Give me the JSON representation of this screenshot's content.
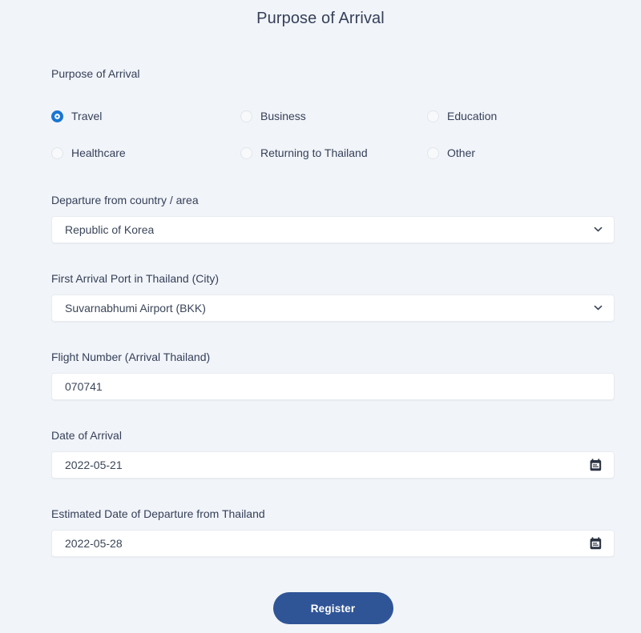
{
  "page": {
    "title": "Purpose of Arrival",
    "background_color": "#f1f4f8",
    "accent_color": "#2f5597",
    "radio_selected_color": "#1976d2"
  },
  "purpose_section": {
    "label": "Purpose of Arrival",
    "options": [
      {
        "label": "Travel",
        "selected": true
      },
      {
        "label": "Business",
        "selected": false
      },
      {
        "label": "Education",
        "selected": false
      },
      {
        "label": "Healthcare",
        "selected": false
      },
      {
        "label": "Returning to Thailand",
        "selected": false
      },
      {
        "label": "Other",
        "selected": false
      }
    ]
  },
  "fields": {
    "departure_country": {
      "label": "Departure from country / area",
      "value": "Republic of Korea",
      "type": "select",
      "icon": "chevron-down-icon"
    },
    "arrival_port": {
      "label": "First Arrival Port in Thailand (City)",
      "value": "Suvarnabhumi Airport (BKK)",
      "type": "select",
      "icon": "chevron-down-icon"
    },
    "flight_number": {
      "label": "Flight Number (Arrival Thailand)",
      "value": "070741",
      "type": "text"
    },
    "date_of_arrival": {
      "label": "Date of Arrival",
      "value": "2022-05-21",
      "type": "date",
      "icon": "calendar-icon"
    },
    "date_of_departure": {
      "label": "Estimated Date of Departure from Thailand",
      "value": "2022-05-28",
      "type": "date",
      "icon": "calendar-icon"
    }
  },
  "submit": {
    "label": "Register"
  }
}
